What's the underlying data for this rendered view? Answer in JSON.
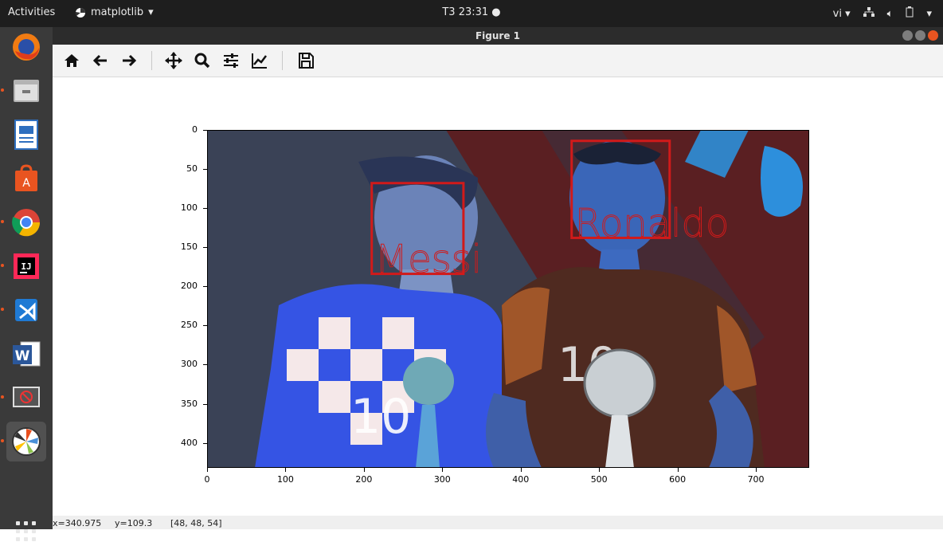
{
  "topbar": {
    "activities": "Activities",
    "app_name": "matplotlib",
    "clock": "T3 23:31 ●",
    "lang": "vi",
    "icons": [
      "network-icon",
      "volume-icon",
      "battery-icon",
      "menu-chevron-icon"
    ]
  },
  "dock": {
    "items": [
      "firefox-icon",
      "files-icon",
      "writer-icon",
      "software-center-icon",
      "chrome-icon",
      "intellij-icon",
      "vscode-icon",
      "word-icon",
      "blocked-app-icon",
      "matplotlib-icon"
    ],
    "show_apps": "show-applications-icon"
  },
  "window": {
    "title": "Figure 1"
  },
  "toolbar": {
    "buttons": [
      "home",
      "back",
      "forward",
      "pan",
      "zoom",
      "configure-subplots",
      "edit-axis",
      "save"
    ]
  },
  "figure": {
    "y_ticks": [
      "0",
      "50",
      "100",
      "150",
      "200",
      "250",
      "300",
      "350",
      "400"
    ],
    "x_ticks": [
      "0",
      "100",
      "200",
      "300",
      "400",
      "500",
      "600",
      "700"
    ],
    "boxes": [
      {
        "label": "Messi",
        "x0": 210,
        "y0": 68,
        "x1": 327,
        "y1": 184
      },
      {
        "label": "Ronaldo",
        "x0": 465,
        "y0": 14,
        "x1": 590,
        "y1": 138
      }
    ],
    "image_extent": {
      "xmax": 768,
      "ymax": 432
    },
    "box_color": "#d11a1a"
  },
  "status": {
    "x": "x=340.975",
    "y": "y=109.3",
    "rgb": "[48, 48, 54]"
  },
  "colors": {
    "accent": "#e95420"
  }
}
